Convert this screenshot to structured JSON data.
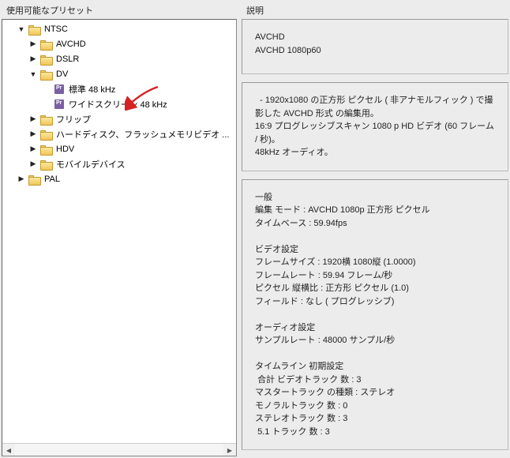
{
  "leftPanel": {
    "title": "使用可能なプリセット"
  },
  "rightPanel": {
    "title": "説明"
  },
  "tree": {
    "ntsc": "NTSC",
    "avchd": "AVCHD",
    "dslr": "DSLR",
    "dv": "DV",
    "preset_std": "標準 48 kHz",
    "preset_wide": "ワイドスクリーン 48 kHz",
    "flip": "フリップ",
    "hdd": "ハードディスク、フラッシュメモリビデオ ...",
    "hdv": "HDV",
    "mobile": "モバイルデバイス",
    "pal": "PAL"
  },
  "desc1": {
    "line1": "AVCHD",
    "line2": "AVCHD 1080p60"
  },
  "desc2": {
    "line1": "  - 1920x1080 の正方形 ピクセル ( 非アナモルフィック ) で撮影した AVCHD 形式 の編集用。",
    "line2": "16:9 プログレッシブスキャン 1080 p HD ビデオ (60 フレーム / 秒)。",
    "line3": "48kHz オーディオ。"
  },
  "desc3": {
    "sec1_h": "一般",
    "sec1_l1": "編集 モード : AVCHD 1080p 正方形 ピクセル",
    "sec1_l2": "タイムベース : 59.94fps",
    "sec2_h": "ビデオ設定",
    "sec2_l1": "フレームサイズ : 1920横 1080縦 (1.0000)",
    "sec2_l2": "フレームレート : 59.94 フレーム/秒",
    "sec2_l3": "ピクセル 縦横比 : 正方形 ピクセル (1.0)",
    "sec2_l4": "フィールド : なし ( プログレッシブ)",
    "sec3_h": "オーディオ設定",
    "sec3_l1": "サンプルレート : 48000 サンプル/秒",
    "sec4_h": "タイムライン 初期設定",
    "sec4_l1": " 合計 ビデオトラック 数 : 3",
    "sec4_l2": "マスタートラック の種類 : ステレオ",
    "sec4_l3": "モノラルトラック 数 : 0",
    "sec4_l4": "ステレオトラック 数 : 3",
    "sec4_l5": " 5.1 トラック 数 : 3"
  }
}
